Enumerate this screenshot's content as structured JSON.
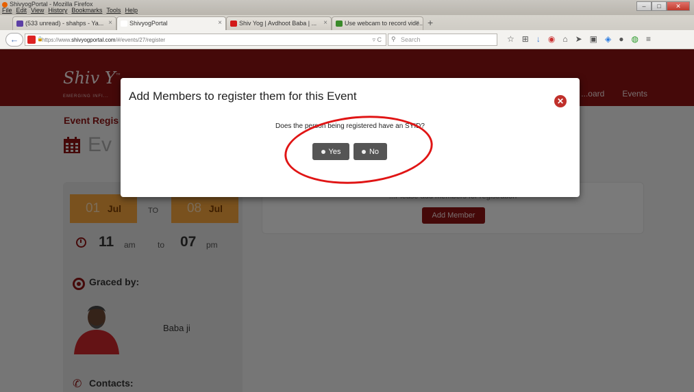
{
  "window": {
    "title": "ShivyogPortal - Mozilla Firefox",
    "min": "–",
    "max": "□",
    "close": "✕"
  },
  "menu": [
    "File",
    "Edit",
    "View",
    "History",
    "Bookmarks",
    "Tools",
    "Help"
  ],
  "tabs": [
    {
      "label": "(533 unread) - shahps - Ya...",
      "icon_color": "#5c3fa5",
      "close": "×"
    },
    {
      "label": "ShivyogPortal",
      "icon_color": "#ffffff",
      "close": "×"
    },
    {
      "label": "Shiv Yog | Avdhoot Baba | ...",
      "icon_color": "#d21919",
      "close": "×"
    },
    {
      "label": "Use webcam to record vide...",
      "icon_color": "#3a8a2a",
      "close": "×"
    }
  ],
  "new_tab": "+",
  "navbar": {
    "back": "←",
    "url_prefix": "https://www.",
    "url_host": "shivyogportal.com",
    "url_path": "/#/events/27/register",
    "reload": "▿ C",
    "search_placeholder": "Search",
    "toolbar_icons": [
      "star-icon",
      "reading-list-icon",
      "download-icon",
      "extension-icon",
      "home-icon",
      "send-icon",
      "youtube-icon",
      "dropbox-icon",
      "chat-icon",
      "addon-icon",
      "menu-icon"
    ],
    "toolbar_glyphs": [
      "☆",
      "⊞",
      "↓",
      "◉",
      "⌂",
      "➤",
      "▣",
      "◈",
      "●",
      "◍",
      "≡"
    ]
  },
  "site": {
    "logo": "Shiv Y",
    "logo_tm": "™",
    "logo_sub": "EMERGING INFI...",
    "nav": [
      "...oard",
      "Events"
    ],
    "brand_color": "#8b1212",
    "event_title": "Event Regis",
    "event_heading": "Ev",
    "date_from": {
      "day": "01",
      "month": "Jul"
    },
    "date_to_label": "TO",
    "date_to": {
      "day": "08",
      "month": "Jul"
    },
    "time_from": {
      "hour": "11",
      "unit": "am"
    },
    "time_to_label": "to",
    "time_to": {
      "hour": "07",
      "unit": "pm"
    },
    "graced_label": "Graced by:",
    "guru_name": "Baba ji",
    "contacts_label": "Contacts:",
    "main_message": "...Please add members for registration",
    "add_member": "Add Member"
  },
  "modal": {
    "title": "Add Members to register them for this Event",
    "close": "✕",
    "question": "Does the person being registered have an SYID?",
    "yes": "Yes",
    "no": "No"
  },
  "annotation": {
    "color": "#e01515"
  }
}
